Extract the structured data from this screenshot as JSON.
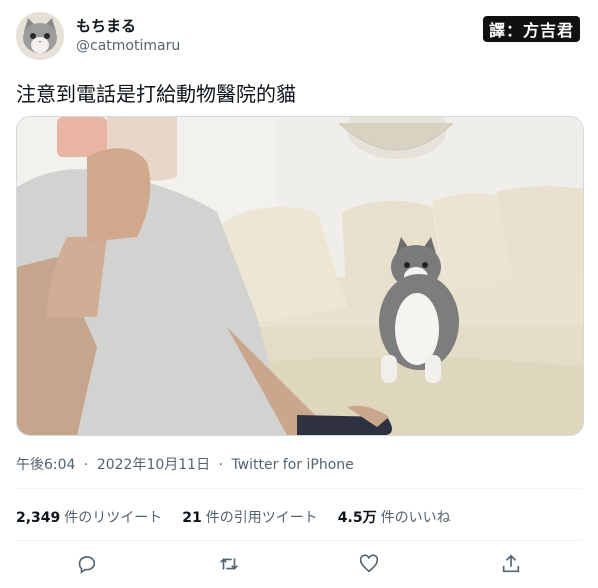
{
  "user": {
    "display_name": "もちまる",
    "handle": "@catmotimaru"
  },
  "watermark": "譯：方吉君",
  "tweet": {
    "text": "注意到電話是打給動物醫院的貓"
  },
  "meta": {
    "time": "午後6:04",
    "date": "2022年10月11日",
    "client": "Twitter for iPhone",
    "separator": "·"
  },
  "stats": [
    {
      "count": "2,349",
      "label": "件のリツイート"
    },
    {
      "count": "21",
      "label": "件の引用ツイート"
    },
    {
      "count": "4.5万",
      "label": "件のいいね"
    }
  ],
  "actions": [
    "reply-icon",
    "retweet-icon",
    "like-icon",
    "share-icon"
  ]
}
